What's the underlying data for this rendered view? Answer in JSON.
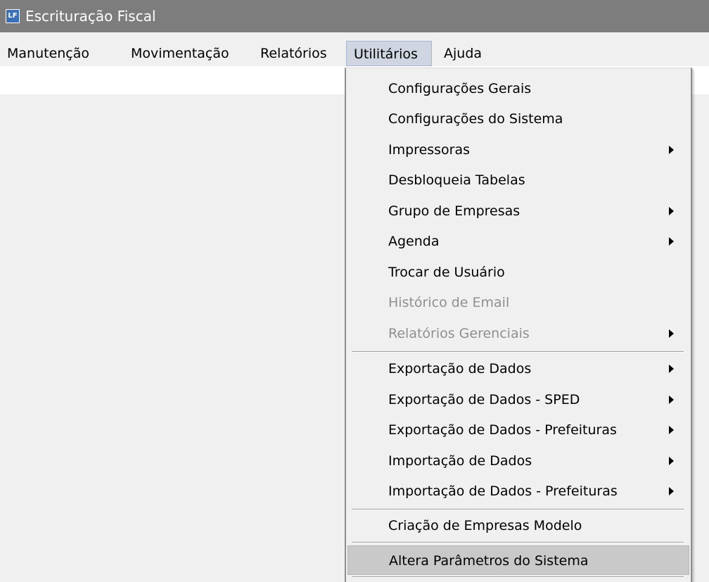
{
  "window": {
    "icon_text": "LF",
    "title": "Escrituração Fiscal"
  },
  "menubar": {
    "items": [
      {
        "label": "Manutenção"
      },
      {
        "label": "Movimentação"
      },
      {
        "label": "Relatórios"
      },
      {
        "label": "Utilitários",
        "active": true
      },
      {
        "label": "Ajuda"
      }
    ]
  },
  "utilitarios_menu": {
    "items": [
      {
        "label": "Configurações Gerais",
        "submenu": false,
        "enabled": true
      },
      {
        "label": "Configurações do Sistema",
        "submenu": false,
        "enabled": true
      },
      {
        "label": "Impressoras",
        "submenu": true,
        "enabled": true
      },
      {
        "label": "Desbloqueia Tabelas",
        "submenu": false,
        "enabled": true
      },
      {
        "label": "Grupo de Empresas",
        "submenu": true,
        "enabled": true
      },
      {
        "label": "Agenda",
        "submenu": true,
        "enabled": true
      },
      {
        "label": "Trocar de Usuário",
        "submenu": false,
        "enabled": true
      },
      {
        "label": "Histórico de Email",
        "submenu": false,
        "enabled": false
      },
      {
        "label": "Relatórios Gerenciais",
        "submenu": true,
        "enabled": false
      },
      {
        "label": "Exportação de Dados",
        "submenu": true,
        "enabled": true
      },
      {
        "label": "Exportação de Dados - SPED",
        "submenu": true,
        "enabled": true
      },
      {
        "label": "Exportação de Dados - Prefeituras",
        "submenu": true,
        "enabled": true
      },
      {
        "label": "Importação de Dados",
        "submenu": true,
        "enabled": true
      },
      {
        "label": "Importação de Dados - Prefeituras",
        "submenu": true,
        "enabled": true
      },
      {
        "label": "Criação de Empresas Modelo",
        "submenu": false,
        "enabled": true
      },
      {
        "label": "Altera Parâmetros do Sistema",
        "submenu": false,
        "enabled": true,
        "highlighted": true
      }
    ]
  },
  "colors": {
    "titlebar": "#7d7d7d",
    "menu_background": "#f0f0f0",
    "active_menu": "#cfd6e2",
    "highlighted_item": "#c9c9c9",
    "disabled_text": "#8f8f8f"
  }
}
